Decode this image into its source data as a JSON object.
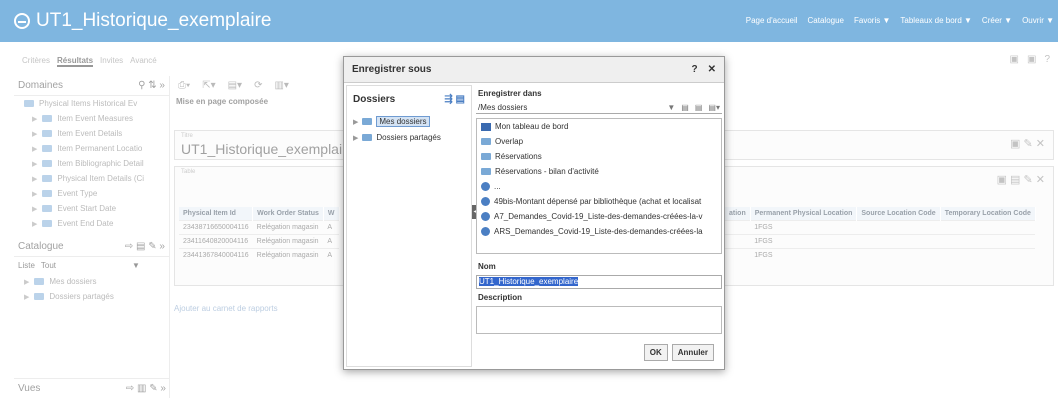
{
  "topbar": {
    "title": "UT1_Historique_exemplaire",
    "nav": [
      "Page d'accueil",
      "Catalogue",
      "Favoris ▼",
      "Tableaux de bord ▼",
      "Créer ▼",
      "Ouvrir ▼"
    ]
  },
  "subtabs": [
    "Critères",
    "Résultats",
    "Invites",
    "Avancé"
  ],
  "left": {
    "domains_title": "Domaines",
    "domain_items": [
      "Physical Items Historical Ev",
      "Item Event Measures",
      "Item Event Details",
      "Item Permanent Locatio",
      "Item Bibliographic Detail",
      "Physical Item Details (Ci",
      "Event Type",
      "Event Start Date",
      "Event End Date"
    ],
    "catalogue_title": "Catalogue",
    "liste_label": "Liste",
    "liste_value": "Tout",
    "catalogue_items": [
      "Mes dossiers",
      "Dossiers partagés"
    ],
    "vues_title": "Vues"
  },
  "main": {
    "mise": "Mise en page composée",
    "titre_label": "Titre",
    "titre_value": "UT1_Historique_exemplaire",
    "table_label": "Table",
    "headers": [
      "Physical Item Id",
      "Work Order Status",
      "W"
    ],
    "rows": [
      [
        "23438716650004116",
        "Relégation magasin",
        "A"
      ],
      [
        "23411640820004116",
        "Relégation magasin",
        "A"
      ],
      [
        "23441367840004116",
        "Relégation magasin",
        "A"
      ]
    ],
    "right_headers": [
      "ation",
      "Permanent Physical Location",
      "Source Location Code",
      "Temporary Location Code"
    ],
    "right_rows": [
      "1FGS",
      "1FGS",
      "1FGS"
    ],
    "ajouter": "Ajouter au carnet de rapports"
  },
  "dialog": {
    "title": "Enregistrer sous",
    "dossiers_title": "Dossiers",
    "dossiers_items": [
      "Mes dossiers",
      "Dossiers partagés"
    ],
    "enregistrer_dans": "Enregistrer dans",
    "path": "/Mes dossiers",
    "files": [
      "Mon tableau de bord",
      "Overlap",
      "Réservations",
      "Réservations - bilan d'activité",
      "...",
      "49bis-Montant dépensé par bibliothèque (achat et localisat",
      "A7_Demandes_Covid-19_Liste-des-demandes-créées-la-v",
      "ARS_Demandes_Covid-19_Liste-des-demandes-créées-la"
    ],
    "nom_label": "Nom",
    "nom_value": "UT1_Historique_exemplaire",
    "description_label": "Description",
    "ok": "OK",
    "annuler": "Annuler"
  }
}
